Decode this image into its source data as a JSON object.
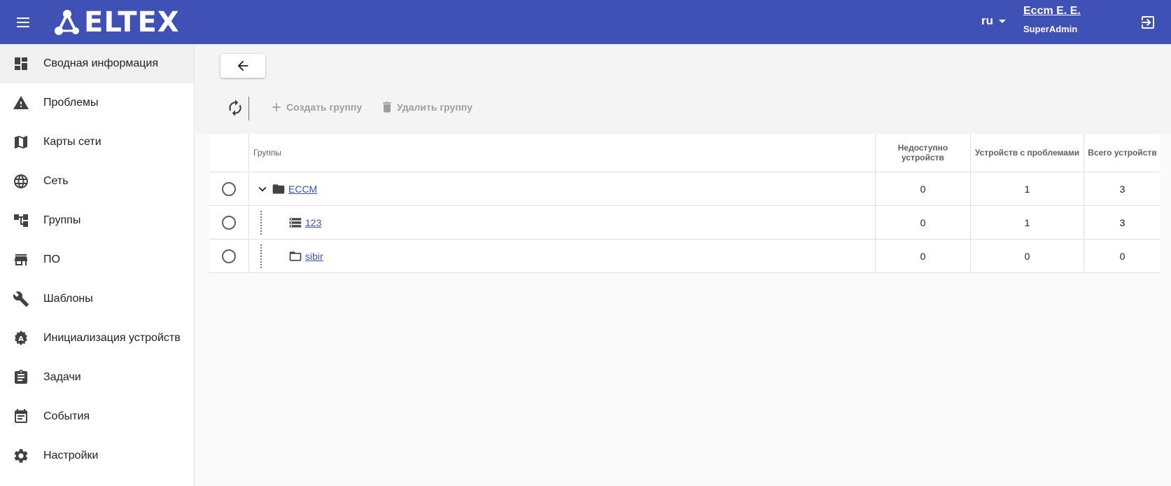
{
  "header": {
    "logo_text": "ELTEX",
    "lang": "ru",
    "user_name": "Eccm E. E.",
    "user_role": "SuperAdmin",
    "bg_color": "#3f51b5"
  },
  "sidebar": {
    "items": [
      {
        "label": "Сводная информация",
        "icon": "dashboard-icon"
      },
      {
        "label": "Проблемы",
        "icon": "warning-icon"
      },
      {
        "label": "Карты сети",
        "icon": "map-icon"
      },
      {
        "label": "Сеть",
        "icon": "globe-icon"
      },
      {
        "label": "Группы",
        "icon": "groups-tree-icon"
      },
      {
        "label": "ПО",
        "icon": "store-icon"
      },
      {
        "label": "Шаблоны",
        "icon": "wrench-icon"
      },
      {
        "label": "Инициализация устройств",
        "icon": "init-badge-icon"
      },
      {
        "label": "Задачи",
        "icon": "clipboard-icon"
      },
      {
        "label": "События",
        "icon": "calendar-icon"
      },
      {
        "label": "Настройки",
        "icon": "gear-icon"
      }
    ]
  },
  "toolbar": {
    "create_label": "Создать группу",
    "delete_label": "Удалить группу"
  },
  "table": {
    "headers": {
      "groups": "Группы",
      "unavailable": "Недоступно устройств",
      "problems": "Устройств с проблемами",
      "total": "Всего устройств"
    },
    "rows": [
      {
        "name": "ECCM",
        "unavailable": "0",
        "problems": "1",
        "total": "3"
      },
      {
        "name": "123",
        "unavailable": "0",
        "problems": "1",
        "total": "3"
      },
      {
        "name": "sibir",
        "unavailable": "0",
        "problems": "0",
        "total": "0"
      }
    ]
  }
}
